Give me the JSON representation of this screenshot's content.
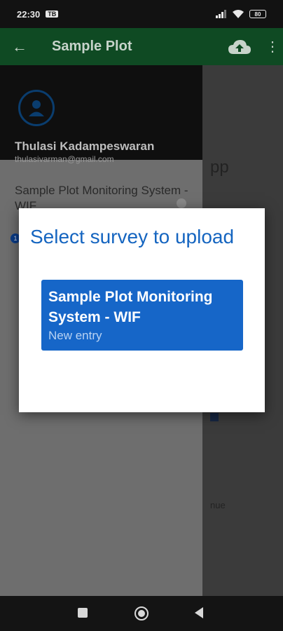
{
  "status_bar": {
    "time": "22:30",
    "notification_label": "TB",
    "battery": "80",
    "icons": [
      "signal-icon",
      "wifi-icon",
      "battery-icon"
    ]
  },
  "app_bar": {
    "title": "Sample Plot",
    "back_icon": "arrow-left-icon",
    "upload_icon": "cloud-upload-icon",
    "more_icon": "more-vert-icon"
  },
  "drawer": {
    "user_name": "Thulasi Kadampeswaran",
    "user_email": "thulasivarman@gmail.com",
    "item_label": "Sample Plot Monitoring System - WIF",
    "badge": "1"
  },
  "background": {
    "partial_text": "pp",
    "partial_text2": "nue"
  },
  "dialog": {
    "title": "Select survey to upload",
    "surveys": [
      {
        "name": "Sample Plot Monitoring System - WIF",
        "status": "New entry"
      }
    ]
  },
  "colors": {
    "app_bar": "#0f4a23",
    "accent_blue": "#1666c8",
    "dialog_title": "#1565c0"
  }
}
